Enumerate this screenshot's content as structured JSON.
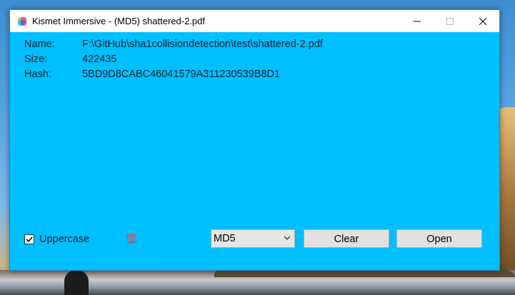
{
  "window": {
    "title": "Kismet Immersive - (MD5) shattered-2.pdf",
    "background": "#00bfff"
  },
  "info": {
    "name_label": "Name:",
    "name_value": "F:\\GitHub\\sha1collisiondetection\\test\\shattered-2.pdf",
    "size_label": "Size:",
    "size_value": "422435",
    "hash_label": "Hash:",
    "hash_value": "5BD9D8CABC46041579A311230539B8D1"
  },
  "controls": {
    "uppercase_label": "Uppercase",
    "uppercase_checked": true,
    "emoji": "💯",
    "algorithm_selected": "MD5",
    "clear_label": "Clear",
    "open_label": "Open"
  }
}
